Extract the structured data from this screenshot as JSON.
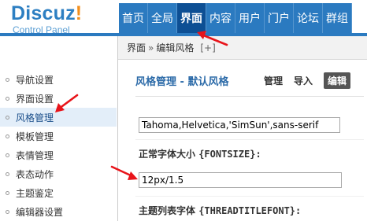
{
  "logo": {
    "title": "Discuz",
    "bang": "!",
    "subtitle": "Control Panel"
  },
  "topnav": {
    "items": [
      {
        "label": "首页"
      },
      {
        "label": "全局"
      },
      {
        "label": "界面"
      },
      {
        "label": "内容"
      },
      {
        "label": "用户"
      },
      {
        "label": "门户"
      },
      {
        "label": "论坛"
      },
      {
        "label": "群组"
      }
    ],
    "active_index": 2
  },
  "breadcrumb": {
    "section": "界面",
    "separator": "»",
    "page": "编辑风格",
    "plus": "[+]"
  },
  "sidebar": {
    "items": [
      {
        "label": "导航设置"
      },
      {
        "label": "界面设置"
      },
      {
        "label": "风格管理"
      },
      {
        "label": "模板管理"
      },
      {
        "label": "表情管理"
      },
      {
        "label": "表态动作"
      },
      {
        "label": "主题鉴定"
      },
      {
        "label": "编辑器设置"
      }
    ],
    "active_index": 2
  },
  "page": {
    "title": "风格管理 - 默认风格",
    "tabs": [
      {
        "label": "管理"
      },
      {
        "label": "导入"
      },
      {
        "label": "编辑"
      }
    ],
    "active_tab_index": 2
  },
  "form": {
    "font_value": "Tahoma,Helvetica,'SimSun',sans-serif",
    "fontsize_label": "正常字体大小",
    "fontsize_var": "{FONTSIZE}:",
    "fontsize_value": "12px/1.5",
    "threadtitle_label": "主题列表字体",
    "threadtitle_var": "{THREADTITLEFONT}:"
  },
  "colors": {
    "nav_bg": "#2b7ac0",
    "nav_active": "#0d4f94",
    "title_blue": "#2b6aa8",
    "annotation_arrow": "#e8141a",
    "logo_blue": "#2d7fc2",
    "logo_orange": "#f38f1c"
  }
}
